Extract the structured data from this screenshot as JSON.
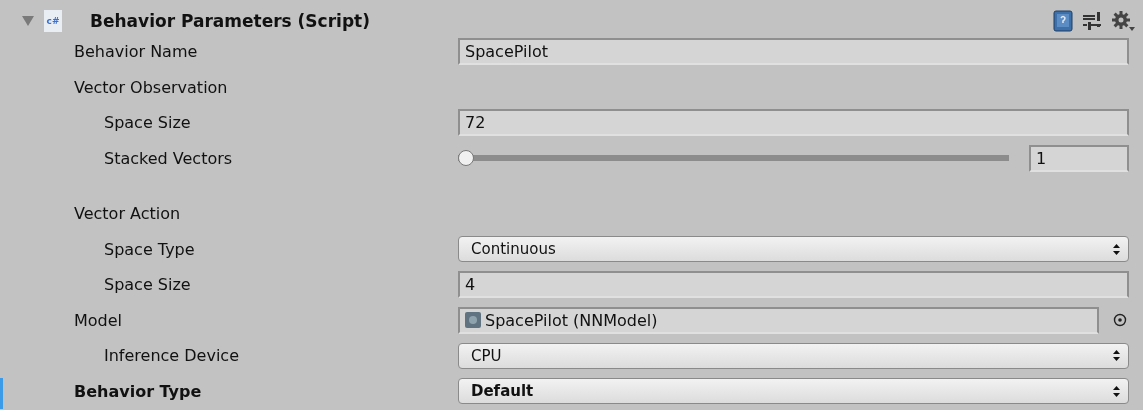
{
  "component": {
    "expanded": true,
    "title": "Behavior Parameters (Script)",
    "script_badge": "c#"
  },
  "fields": [
    {
      "label": "Behavior Name",
      "kind": "text",
      "value": "SpacePilot",
      "overridden": false
    },
    {
      "label": "Vector Observation",
      "kind": "group",
      "overridden": false,
      "children": [
        {
          "label": "Space Size",
          "kind": "text",
          "value": "72",
          "overridden": false
        },
        {
          "label": "Stacked Vectors",
          "kind": "slider",
          "level": 0,
          "value": "1",
          "overridden": false
        }
      ]
    },
    {
      "label": "Vector Action",
      "kind": "group",
      "overridden": false,
      "children": [
        {
          "label": "Space Type",
          "kind": "dropdown",
          "value": "Continuous",
          "overridden": false
        },
        {
          "label": "Space Size",
          "kind": "text",
          "value": "4",
          "overridden": false
        }
      ]
    },
    {
      "label": "Model",
      "kind": "object",
      "value": "SpacePilot (NNModel)",
      "overridden": false,
      "children": [
        {
          "label": "Inference Device",
          "kind": "dropdown",
          "value": "CPU",
          "overridden": false
        }
      ]
    },
    {
      "label": "Behavior Type",
      "kind": "dropdown",
      "value": "Default",
      "overridden": true
    }
  ]
}
